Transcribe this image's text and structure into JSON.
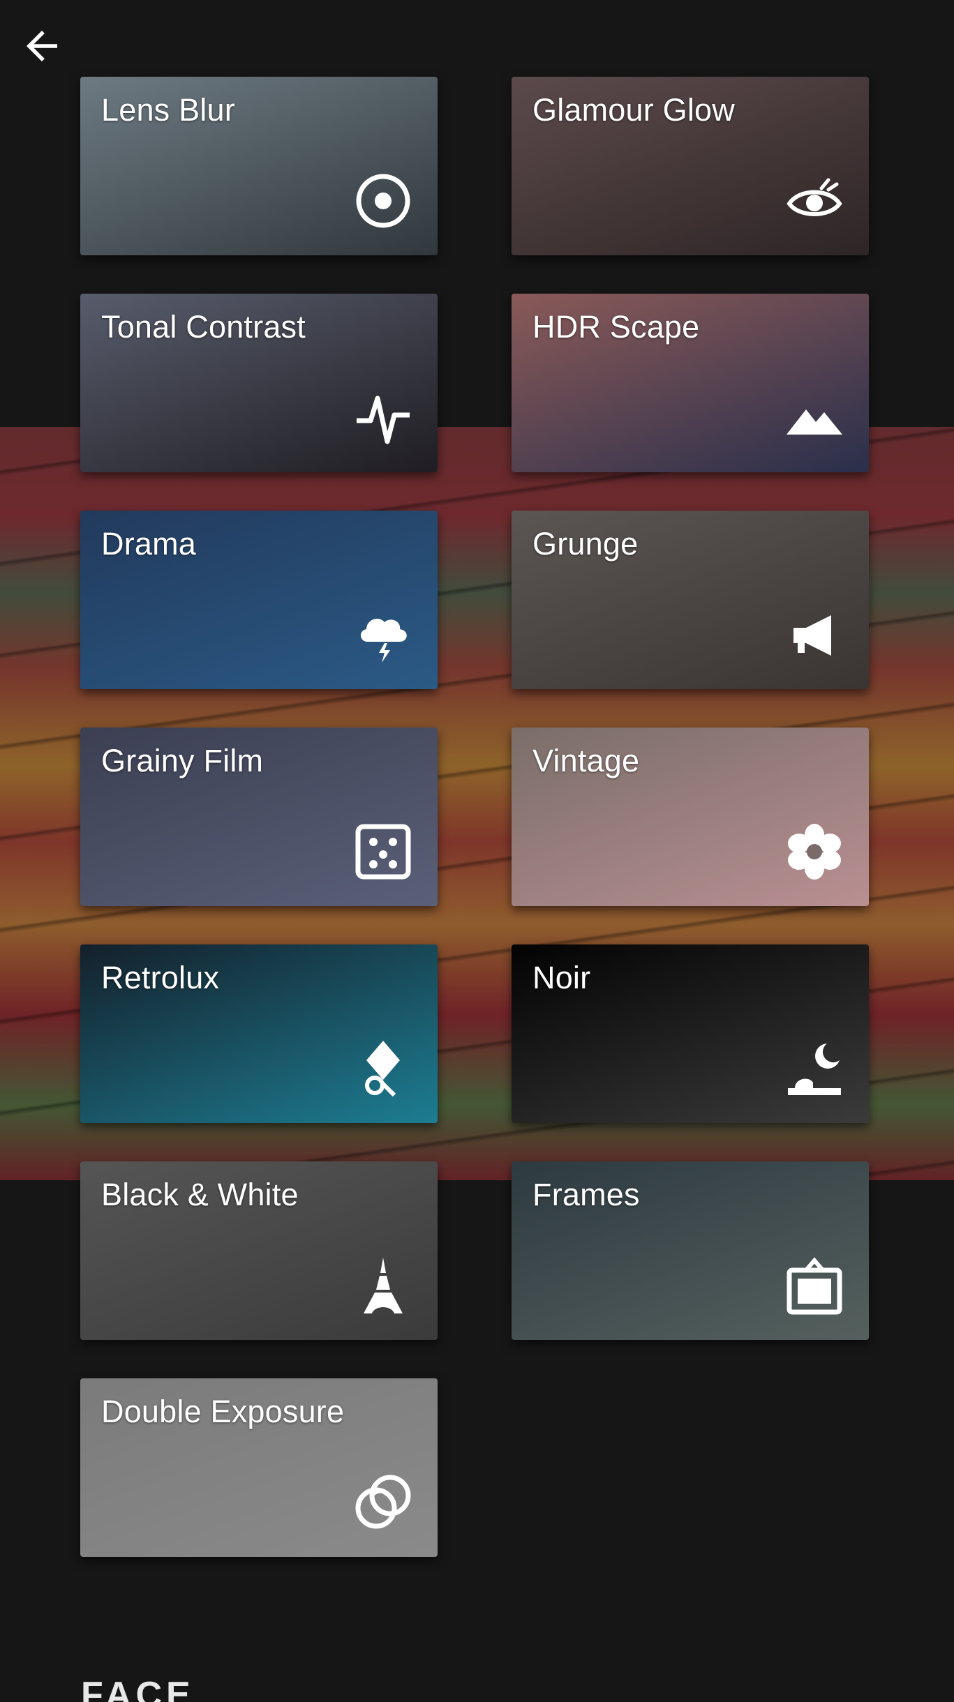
{
  "nav": {
    "back_icon": "arrow-back-icon"
  },
  "tools": [
    {
      "label": "Lens Blur",
      "icon": "target-icon",
      "colors": [
        "#6d7a82",
        "#31383d"
      ]
    },
    {
      "label": "Glamour Glow",
      "icon": "eye-icon",
      "colors": [
        "#5c4a4b",
        "#2e2526"
      ]
    },
    {
      "label": "Tonal Contrast",
      "icon": "pulse-icon",
      "colors": [
        "#585c6c",
        "#1f1d22"
      ]
    },
    {
      "label": "HDR Scape",
      "icon": "mountains-icon",
      "colors": [
        "#8a5a58",
        "#2a2f4b"
      ]
    },
    {
      "label": "Drama",
      "icon": "thunder-cloud-icon",
      "colors": [
        "#223a5c",
        "#2b5a86"
      ]
    },
    {
      "label": "Grunge",
      "icon": "megaphone-icon",
      "colors": [
        "#5b5553",
        "#3a3533"
      ]
    },
    {
      "label": "Grainy Film",
      "icon": "dice-icon",
      "colors": [
        "#3c3f52",
        "#5a6078"
      ]
    },
    {
      "label": "Vintage",
      "icon": "flower-icon",
      "colors": [
        "#7a6e69",
        "#b98f92"
      ]
    },
    {
      "label": "Retrolux",
      "icon": "retrolux-icon",
      "colors": [
        "#14202b",
        "#1d7d92"
      ]
    },
    {
      "label": "Noir",
      "icon": "moon-horizon-icon",
      "colors": [
        "#030303",
        "#3b3b3b"
      ]
    },
    {
      "label": "Black & White",
      "icon": "eiffel-tower-icon",
      "colors": [
        "#555555",
        "#3b3b3b"
      ]
    },
    {
      "label": "Frames",
      "icon": "frame-icon",
      "colors": [
        "#2d3a40",
        "#55605e"
      ]
    },
    {
      "label": "Double Exposure",
      "icon": "double-circle-icon",
      "colors": [
        "#7b7b7b",
        "#8a8a8a"
      ]
    }
  ],
  "footer": {
    "section_title": "FACE"
  }
}
